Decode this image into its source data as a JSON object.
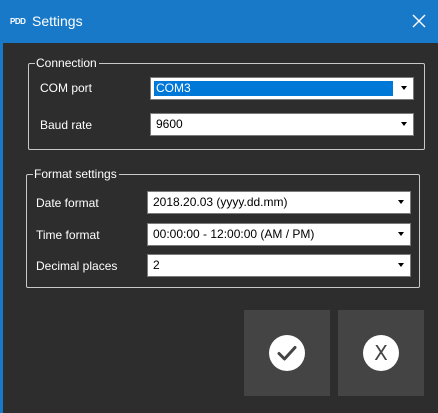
{
  "window": {
    "title": "Settings",
    "app_icon_text": "PDD",
    "titlebar_color": "#1879c9",
    "close_icon": "close-icon"
  },
  "connection": {
    "legend": "Connection",
    "com_port": {
      "label": "COM port",
      "value": "COM3"
    },
    "baud_rate": {
      "label": "Baud rate",
      "value": "9600"
    }
  },
  "format": {
    "legend": "Format settings",
    "date_format": {
      "label": "Date format",
      "value": "2018.20.03 (yyyy.dd.mm)"
    },
    "time_format": {
      "label": "Time format",
      "value": "00:00:00 - 12:00:00 (AM / PM)"
    },
    "decimal_places": {
      "label": "Decimal places",
      "value": "2"
    }
  },
  "buttons": {
    "ok_icon": "checkmark-icon",
    "cancel_icon": "x-icon",
    "cancel_glyph": "X"
  },
  "colors": {
    "background": "#2d2d2d",
    "selection": "#0078d7",
    "button_bg": "#444444"
  }
}
